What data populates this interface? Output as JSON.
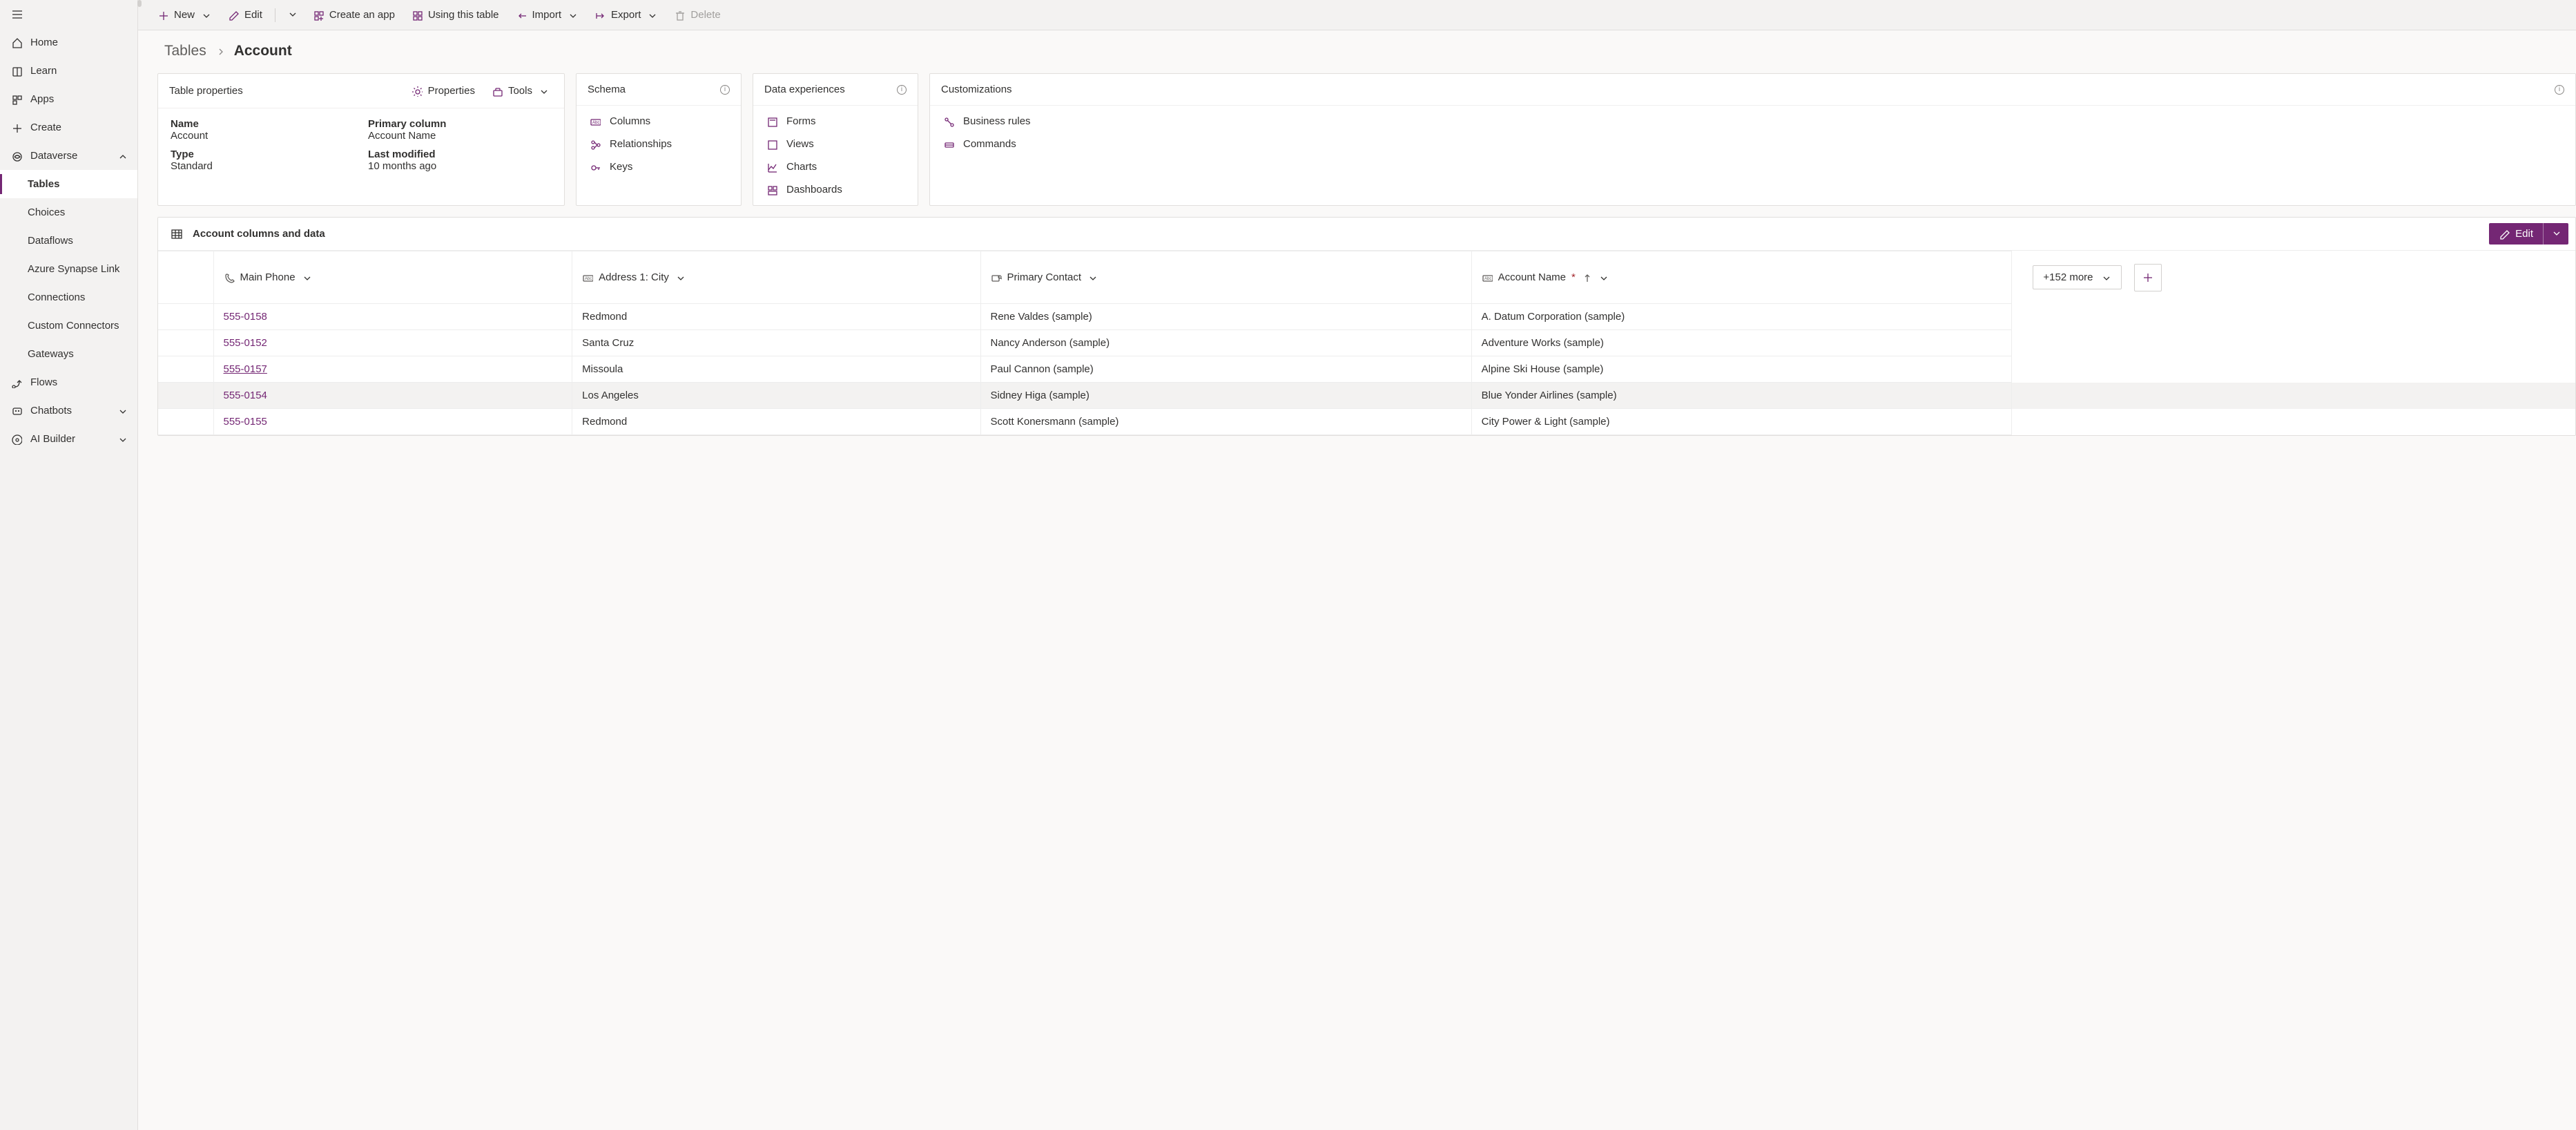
{
  "sidebar": {
    "items": [
      {
        "label": "Home",
        "icon": "home-icon"
      },
      {
        "label": "Learn",
        "icon": "book-icon"
      },
      {
        "label": "Apps",
        "icon": "apps-icon"
      },
      {
        "label": "Create",
        "icon": "plus-icon"
      }
    ],
    "dataverse": {
      "label": "Dataverse",
      "expanded": true,
      "items": [
        {
          "label": "Tables",
          "active": true
        },
        {
          "label": "Choices"
        },
        {
          "label": "Dataflows"
        },
        {
          "label": "Azure Synapse Link"
        },
        {
          "label": "Connections"
        },
        {
          "label": "Custom Connectors"
        },
        {
          "label": "Gateways"
        }
      ]
    },
    "tail": [
      {
        "label": "Flows",
        "icon": "flow-icon"
      },
      {
        "label": "Chatbots",
        "icon": "chatbot-icon",
        "chevron": true
      },
      {
        "label": "AI Builder",
        "icon": "ai-icon",
        "chevron": true
      }
    ]
  },
  "commandBar": {
    "new": "New",
    "edit": "Edit",
    "createApp": "Create an app",
    "usingTable": "Using this table",
    "import": "Import",
    "export": "Export",
    "delete": "Delete"
  },
  "breadcrumb": {
    "parent": "Tables",
    "current": "Account"
  },
  "propsCard": {
    "title": "Table properties",
    "propertiesBtn": "Properties",
    "toolsBtn": "Tools",
    "name_label": "Name",
    "name_value": "Account",
    "primary_label": "Primary column",
    "primary_value": "Account Name",
    "type_label": "Type",
    "type_value": "Standard",
    "modified_label": "Last modified",
    "modified_value": "10 months ago"
  },
  "schemaCard": {
    "title": "Schema",
    "items": [
      "Columns",
      "Relationships",
      "Keys"
    ]
  },
  "expCard": {
    "title": "Data experiences",
    "items": [
      "Forms",
      "Views",
      "Charts",
      "Dashboards"
    ]
  },
  "custCard": {
    "title": "Customizations",
    "items": [
      "Business rules",
      "Commands"
    ]
  },
  "dataSection": {
    "title": "Account columns and data",
    "edit": "Edit",
    "moreColumns": "+152 more",
    "columns": [
      {
        "name": "Main Phone",
        "icon": "phone-icon"
      },
      {
        "name": "Address 1: City",
        "icon": "text-icon"
      },
      {
        "name": "Primary Contact",
        "icon": "lookup-icon"
      },
      {
        "name": "Account Name",
        "icon": "text-icon",
        "required": true,
        "sortAsc": true
      }
    ],
    "rows": [
      {
        "phone": "555-0158",
        "city": "Redmond",
        "contact": "Rene Valdes (sample)",
        "account": "A. Datum Corporation (sample)"
      },
      {
        "phone": "555-0152",
        "city": "Santa Cruz",
        "contact": "Nancy Anderson (sample)",
        "account": "Adventure Works (sample)"
      },
      {
        "phone": "555-0157",
        "city": "Missoula",
        "contact": "Paul Cannon (sample)",
        "account": "Alpine Ski House (sample)",
        "underline": true
      },
      {
        "phone": "555-0154",
        "city": "Los Angeles",
        "contact": "Sidney Higa (sample)",
        "account": "Blue Yonder Airlines (sample)",
        "hover": true
      },
      {
        "phone": "555-0155",
        "city": "Redmond",
        "contact": "Scott Konersmann (sample)",
        "account": "City Power & Light (sample)"
      }
    ]
  },
  "colors": {
    "accent": "#742774"
  }
}
